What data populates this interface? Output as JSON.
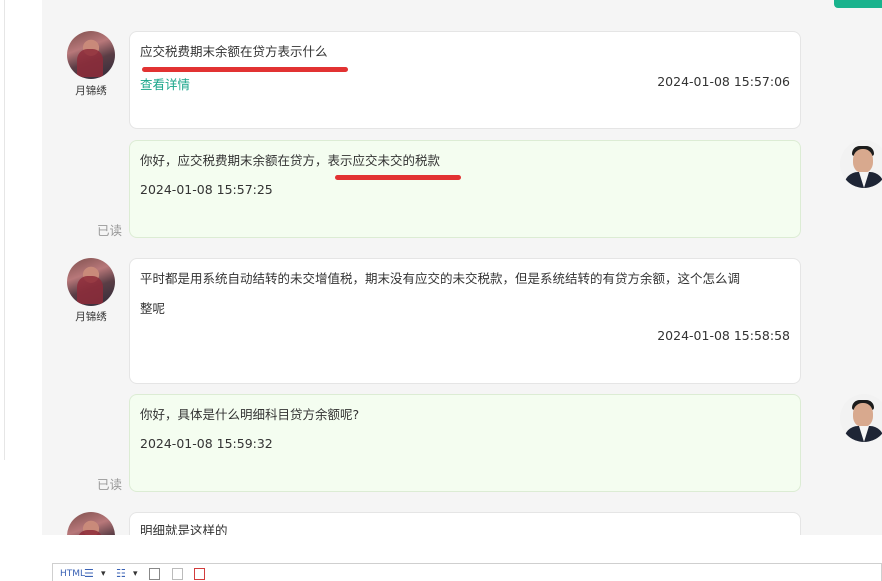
{
  "messages": [
    {
      "sender_name": "月锦绣",
      "text": "应交税费期末余额在贷方表示什么",
      "link": "查看详情",
      "time": "2024-01-08 15:57:06"
    },
    {
      "text": "你好，应交税费期末余额在贷方，表示应交未交的税款",
      "time": "2024-01-08 15:57:25",
      "status": "已读"
    },
    {
      "sender_name": "月锦绣",
      "text_line1": "平时都是用系统自动结转的未交增值税，期末没有应交的未交税款，但是系统结转的有贷方余额，这个怎么调",
      "text_line2": "整呢",
      "time": "2024-01-08 15:58:58"
    },
    {
      "text": "你好，具体是什么明细科目贷方余额呢?",
      "time": "2024-01-08 15:59:32",
      "status": "已读"
    },
    {
      "text": "明细就是这样的"
    }
  ],
  "toolbar": {
    "html_label": "HTML",
    "ordered_list_icon": "ordered-list-icon",
    "unordered_list_icon": "unordered-list-icon",
    "dropdown_glyph": "▾"
  },
  "colors": {
    "accent": "#19b38d",
    "link": "#19a58a",
    "agent_bubble": "#f4fdf0",
    "annotation_red": "#e23232"
  }
}
